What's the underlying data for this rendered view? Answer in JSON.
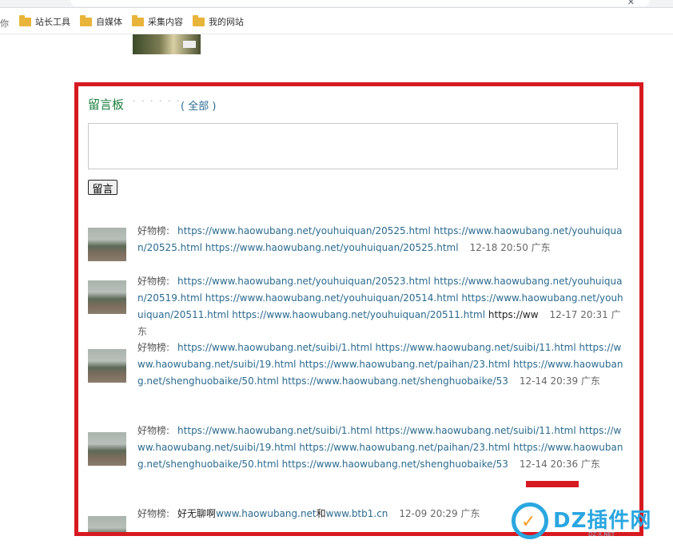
{
  "browser": {
    "bookmarks_cut": "你",
    "bookmarks": [
      {
        "label": "站长工具",
        "icon": "folder-icon"
      },
      {
        "label": "自媒体",
        "icon": "folder-icon"
      },
      {
        "label": "采集内容",
        "icon": "folder-icon"
      },
      {
        "label": "我的网站",
        "icon": "folder-icon"
      }
    ]
  },
  "guestbook": {
    "title": "留言板",
    "dots": "· · · · · ·",
    "all_link": "( 全部 )",
    "submit_label": "留言",
    "messages": [
      {
        "nick": "好物榜:",
        "body": "https://www.haowubang.net/youhuiquan/20525.html https://www.haowubang.net/youhuiquan/20525.html https://www.haowubang.net/youhuiquan/20525.html",
        "tail": "",
        "meta": "12-18 20:50 广东"
      },
      {
        "nick": "好物榜:",
        "body": "https://www.haowubang.net/youhuiquan/20523.html https://www.haowubang.net/youhuiquan/20519.html https://www.haowubang.net/youhuiquan/20514.html https://www.haowubang.net/youhuiquan/20511.html https://www.haowubang.net/youhuiquan/20511.html",
        "tail": " https://ww",
        "meta": "12-17 20:31 广东"
      },
      {
        "nick": "好物榜:",
        "body": "https://www.haowubang.net/suibi/1.html https://www.haowubang.net/suibi/11.html https://www.haowubang.net/suibi/19.html https://www.haowubang.net/paihan/23.html https://www.haowubang.net/shenghuobaike/50.html https://www.haowubang.net/shenghuobaike/53",
        "tail": "",
        "meta": "12-14 20:39 广东"
      },
      {
        "nick": "好物榜:",
        "body": "https://www.haowubang.net/suibi/1.html https://www.haowubang.net/suibi/11.html https://www.haowubang.net/suibi/19.html https://www.haowubang.net/paihan/23.html https://www.haowubang.net/shenghuobaike/50.html https://www.haowubang.net/shenghuobaike/53",
        "tail": "",
        "meta": "12-14 20:36 广东"
      },
      {
        "nick": "好物榜:",
        "prefix": "好无聊啊",
        "body": "www.haowubang.net",
        "mid": "和",
        "body2": "www.btb1.cn",
        "meta": "12-09 20:29 广东"
      }
    ]
  },
  "watermark": {
    "text": "DZ插件网",
    "sub": "DZ-X.NET"
  },
  "colors": {
    "panel_border": "#d71920",
    "title_green": "#1a7f3c",
    "link_blue": "#2b6b8f"
  }
}
